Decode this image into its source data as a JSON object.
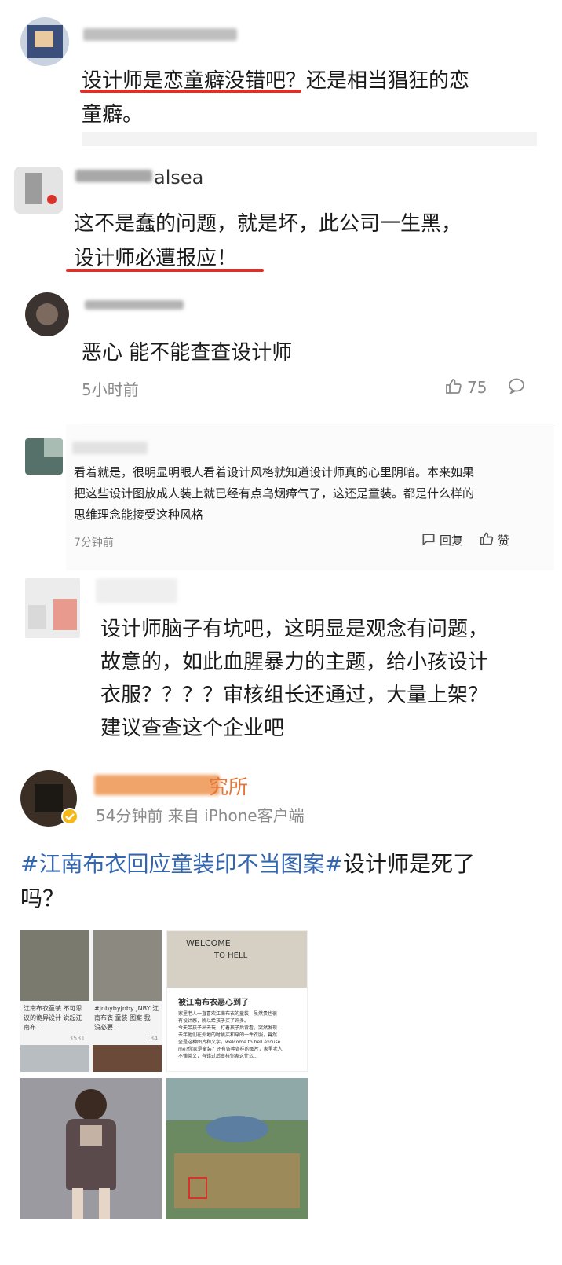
{
  "comments": [
    {
      "username": "",
      "body_line1": "设计师是恋童癖没错吧？还是相当猖狂的恋",
      "body_line2": "童癖。"
    },
    {
      "username_suffix": "alsea",
      "body_line1": "这不是蠢的问题，就是坏，此公司一生黑，",
      "body_line2": "设计师必遭报应！"
    },
    {
      "body": "恶心 能不能查查设计师",
      "time": "5小时前",
      "likes": "75"
    },
    {
      "body_line1": "看着就是，很明显明眼人看着设计风格就知道设计师真的心里阴暗。本来如果",
      "body_line2": "把这些设计图放成人装上就已经有点乌烟瘴气了，这还是童装。都是什么样的",
      "body_line3": "思维理念能接受这种风格",
      "time": "7分钟前",
      "reply_label": "回复",
      "like_label": "赞"
    },
    {
      "body_line1": "设计师脑子有坑吧，这明显是观念有问题，",
      "body_line2": "故意的，如此血腥暴力的主题，给小孩设计",
      "body_line3": "衣服？？？？审核组长还通过，大量上架？",
      "body_line4": "建议查查这个企业吧"
    }
  ],
  "post": {
    "account_suffix": "究所",
    "meta": "54分钟前 来自 iPhone客户端",
    "hashtag": "#江南布衣回应童装印不当图案#",
    "text_after": "设计师是死了",
    "text_line2": "吗？",
    "images": [
      {
        "caption1": "江南布衣童装 不可思",
        "caption2": "议的诡异设计 说起江",
        "caption3": "南布...",
        "stats": "3531"
      },
      {
        "caption1": "#jnbybyjnby JNBY 江",
        "caption2": "南布衣 童装 图案 我",
        "caption3": "没必要...",
        "stats": "134"
      },
      {
        "shirt_text1": "WELCOME",
        "shirt_text2": "TO HELL",
        "card_title": "被江南布衣恶心到了",
        "card_l1": "家里老人一直喜欢江南布衣的童装，虽然贵也很",
        "card_l2": "有设计感，所以给孩子买了许多。",
        "card_l3": "今天带孩子出去玩，打着孩子后背看，突然发现",
        "card_l4": "去年他们在外地的时候买和穿的一件衣服，竟然",
        "card_l5": "全是这种图片和文字，welcome to hell.excuse",
        "card_l6": "me?你家是童装？还有各种各样的图片，家里老人",
        "card_l7": "不懂英文，有错过后审核你家这什么..."
      },
      {
        "label": ""
      },
      {
        "label": ""
      }
    ]
  },
  "colors": {
    "accent_red": "#d8322a",
    "hashtag_blue": "#3266b0",
    "meta_gray": "#8a8a8a"
  }
}
